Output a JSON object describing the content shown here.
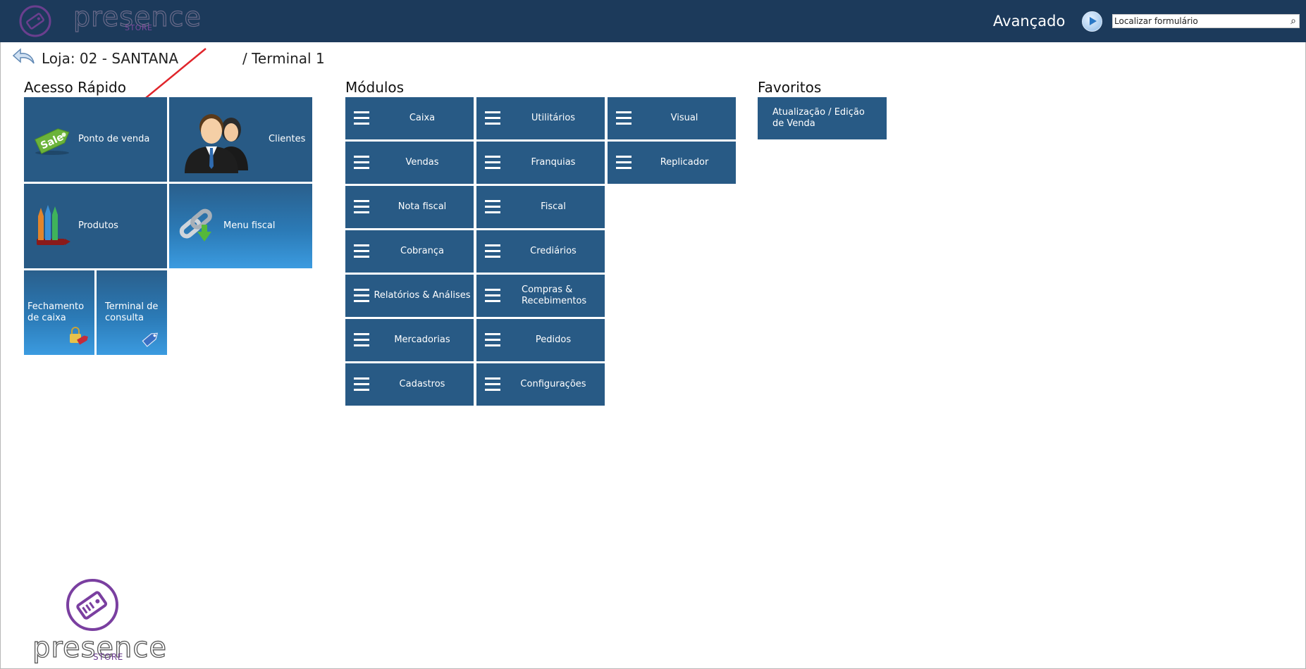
{
  "header": {
    "logo_word": "presence",
    "logo_store": "STORE",
    "advanced_label": "Avançado",
    "play_icon": "play-circle-icon",
    "search": {
      "placeholder": "Localizar formulário",
      "value": ""
    },
    "search_icon": "magnifier-icon"
  },
  "breadcrumb": {
    "back_icon": "back-arrow-icon",
    "store": "Loja: 02 - SANTANA",
    "terminal": "/ Terminal 1"
  },
  "quick_access": {
    "title": "Acesso Rápido",
    "tiles": [
      {
        "label": "Ponto de venda",
        "icon": "sale-tag-icon"
      },
      {
        "label": "Clientes",
        "icon": "people-icon"
      },
      {
        "label": "Produtos",
        "icon": "crayons-icon"
      },
      {
        "label": "Menu fiscal",
        "icon": "chain-download-icon"
      },
      {
        "label": "Fechamento de caixa",
        "icon": "lock-tag-icon"
      },
      {
        "label": "Terminal de consulta",
        "icon": "price-tag-icon"
      }
    ]
  },
  "modules": {
    "title": "Módulos",
    "col1": [
      "Caixa",
      "Vendas",
      "Nota fiscal",
      "Cobrança",
      "Relatórios & Análises",
      "Mercadorias",
      "Cadastros"
    ],
    "col2": [
      "Utilitários",
      "Franquias",
      "Fiscal",
      "Crediários",
      "Compras & Recebimentos",
      "Pedidos",
      "Configurações"
    ],
    "col3": [
      "Visual",
      "Replicador"
    ]
  },
  "favorites": {
    "title": "Favoritos",
    "items": [
      "Atualização / Edição de Venda"
    ]
  },
  "footer": {
    "logo_word": "presence",
    "logo_store": "STORE"
  },
  "colors": {
    "header": "#1c3a5b",
    "tile": "#285a85",
    "accent": "#7a3fa0",
    "arrow": "#e0252b"
  }
}
